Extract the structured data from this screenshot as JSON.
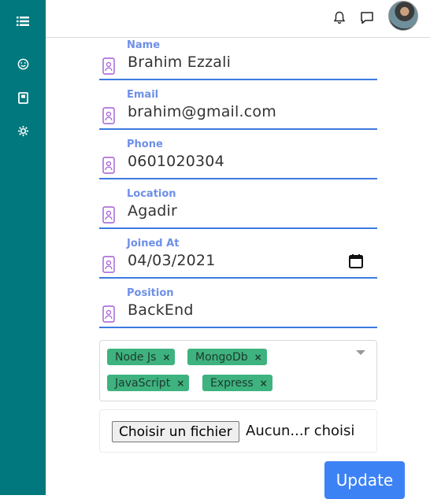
{
  "sidebar": {
    "items": [
      {
        "icon": "list-icon"
      },
      {
        "icon": "smiley-icon"
      },
      {
        "icon": "book-icon"
      },
      {
        "icon": "gear-icon"
      }
    ]
  },
  "topbar": {
    "icons": [
      "bell-icon",
      "chat-icon"
    ],
    "avatar": "avatar"
  },
  "form": {
    "name": {
      "label": "Name",
      "value": "Brahim Ezzali"
    },
    "email": {
      "label": "Email",
      "value": "brahim@gmail.com"
    },
    "phone": {
      "label": "Phone",
      "value": "0601020304"
    },
    "location": {
      "label": "Location",
      "value": "Agadir"
    },
    "joined": {
      "label": "Joined At",
      "value": "04/03/2021"
    },
    "position": {
      "label": "Position",
      "value": "BackEnd"
    },
    "skills": [
      "Node Js",
      "MongoDb",
      "JavaScript",
      "Express"
    ],
    "remove_symbol": "×",
    "file_button": "Choisir un fichier",
    "file_status": "Aucun...r choisi",
    "update_label": "Update"
  },
  "colors": {
    "sidebar": "#00787d",
    "accent": "#3d7be0",
    "label": "#6d8fe8",
    "tag": "#3eb27f",
    "button": "#3d82f5"
  }
}
